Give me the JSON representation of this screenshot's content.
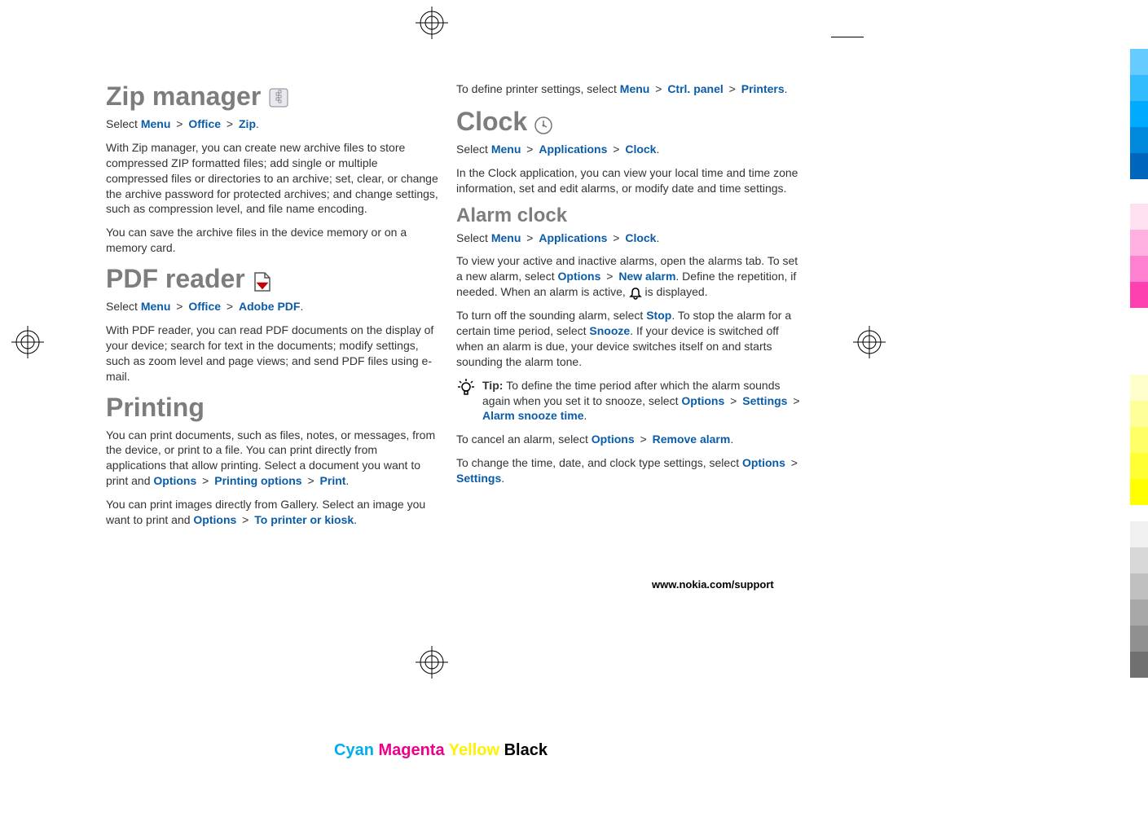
{
  "zip": {
    "title": "Zip manager",
    "sel_pre": "Select ",
    "m1": "Menu",
    "m2": "Office",
    "m3": "Zip",
    "body1": "With Zip manager, you can create new archive files to store compressed ZIP formatted files; add single or multiple compressed files or directories to an archive; set, clear, or change the archive password for protected archives; and change settings, such as compression level, and file name encoding.",
    "body2": "You can save the archive files in the device memory or on a memory card."
  },
  "pdf": {
    "title": "PDF reader",
    "sel_pre": "Select ",
    "m1": "Menu",
    "m2": "Office",
    "m3": "Adobe PDF",
    "body1": "With PDF reader, you can read PDF documents on the display of your device; search for text in the documents; modify settings, such as zoom level and page views; and send PDF files using e-mail."
  },
  "printing": {
    "title": "Printing",
    "body1_pre": "You can print documents, such as files, notes, or messages, from the device, or print to a file. You can print directly from applications that allow printing. Select a document you want to print and ",
    "m1": "Options",
    "m2": "Printing options",
    "m3": "Print",
    "body2_pre": "You can print images directly from Gallery. Select an image you want to print and ",
    "n1": "Options",
    "n2": "To printer or kiosk",
    "body3_pre": "To define printer settings, select ",
    "p1": "Menu",
    "p2": "Ctrl. panel",
    "p3": "Printers"
  },
  "clock": {
    "title": "Clock",
    "sel_pre": "Select ",
    "m1": "Menu",
    "m2": "Applications",
    "m3": "Clock",
    "body1": "In the Clock application, you can view your local time and time zone information, set and edit alarms, or modify date and time settings."
  },
  "alarm": {
    "title": "Alarm clock",
    "sel_pre": "Select ",
    "m1": "Menu",
    "m2": "Applications",
    "m3": "Clock",
    "body1_pre": "To view your active and inactive alarms, open the alarms tab. To set a new alarm, select ",
    "o1": "Options",
    "o2": "New alarm",
    "body1_mid": ". Define the repetition, if needed. When an alarm is active, ",
    "body1_post": " is displayed.",
    "body2_pre": "To turn off the sounding alarm, select ",
    "stop": "Stop",
    "body2_mid": ". To stop the alarm for a certain time period, select ",
    "snooze": "Snooze",
    "body2_post": ". If your device is switched off when an alarm is due, your device switches itself on and starts sounding the alarm tone.",
    "tip_label": "Tip: ",
    "tip_body_pre": "To define the time period after which the alarm sounds again when you set it to snooze, select ",
    "t1": "Options",
    "t2": "Settings",
    "t3": "Alarm snooze time",
    "body3_pre": "To cancel an alarm, select ",
    "r1": "Options",
    "r2": "Remove alarm",
    "body4_pre": "To change the time, date, and clock type settings, select ",
    "s1": "Options",
    "s2": "Settings"
  },
  "footer": {
    "url": "www.nokia.com/support"
  },
  "cmyk": {
    "cyan": "Cyan",
    "magenta": "Magenta",
    "yellow": "Yellow",
    "black": "Black"
  },
  "colorbars": {
    "top": [
      "#66ccff",
      "#33bbff",
      "#00aaff",
      "#0088dd",
      "#0066bb"
    ],
    "mid": [
      "#ffe0f0",
      "#ffb0e0",
      "#ff80d0",
      "#ff40b0"
    ],
    "mid2": [
      "#ffffcc",
      "#ffff99",
      "#ffff66",
      "#ffff33",
      "#ffff00"
    ],
    "bottom": [
      "#f0f0f0",
      "#d8d8d8",
      "#c0c0c0",
      "#a8a8a8",
      "#909090",
      "#707070"
    ]
  }
}
